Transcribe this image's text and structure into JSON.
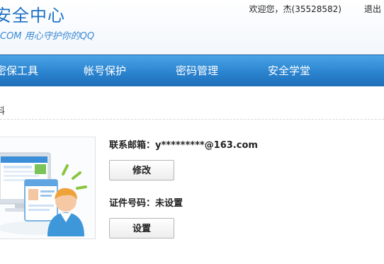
{
  "header": {
    "title": "安全中心",
    "slogan": "COM 用心守护你的QQ",
    "user_info": "欢迎您，杰(35528582)",
    "logout_label": "退出"
  },
  "nav": {
    "items": [
      {
        "label": "密保工具"
      },
      {
        "label": "帐号保护"
      },
      {
        "label": "密码管理"
      },
      {
        "label": "安全学堂"
      }
    ]
  },
  "breadcrumb": "料",
  "account": {
    "email_label": "联系邮箱：",
    "email_value": "y*********@163.com",
    "email_button": "修改",
    "id_label": "证件号码：",
    "id_value": "未设置",
    "id_button": "设置"
  },
  "colors": {
    "nav_blue": "#2b84cf",
    "brand_blue": "#1d71c6"
  }
}
